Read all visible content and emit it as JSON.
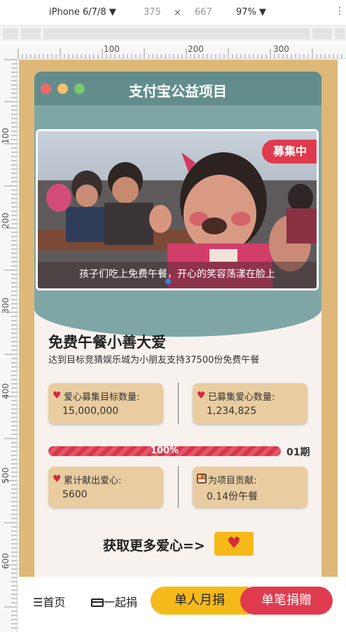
{
  "devtools": {
    "device": "iPhone 6/7/8 ▼",
    "width": "375",
    "times": "×",
    "height": "667",
    "zoom": "97% ▼",
    "more": "⋮"
  },
  "ruler": {
    "marks": [
      "100",
      "200",
      "300"
    ],
    "vmarks": [
      "100",
      "200",
      "300",
      "400",
      "500",
      "600"
    ]
  },
  "header": {
    "title": "支付宝公益项目",
    "dot_colors": [
      "#f2686a",
      "#f5c06b",
      "#79c96b"
    ]
  },
  "banner": {
    "badge": "募集中",
    "caption": "孩子们吃上免费午餐，开心的笑容荡漾在脸上"
  },
  "project": {
    "title": "免费午餐小善大爱",
    "subtitle": "达到目标竞猜娱乐城为小朋友支持37500份免费午餐"
  },
  "stats": [
    {
      "label": "爱心募集目标数量:",
      "value": "15,000,000",
      "icon": "heart-icon"
    },
    {
      "label": "已募集爱心数量:",
      "value": "1,234,825",
      "icon": "heart-icon"
    },
    {
      "label": "累计献出爱心:",
      "value": "5600",
      "icon": "heart-icon"
    },
    {
      "label": "为项目贡献:",
      "value": "0.14份午餐",
      "icon": "lunchbox-icon"
    }
  ],
  "progress": {
    "percent_label": "100%",
    "fraction": 1.0,
    "period": "01期"
  },
  "cta": {
    "label": "获取更多爱心=>",
    "heart": "♥"
  },
  "tabbar": {
    "home": "首页",
    "together": "一起捐",
    "monthly": "单人月捐",
    "single": "单笔捐赠"
  },
  "colors": {
    "accent_red": "#e03a4f",
    "accent_yellow": "#f5b919",
    "teal": "#638d8c",
    "tan": "#ddb878"
  }
}
